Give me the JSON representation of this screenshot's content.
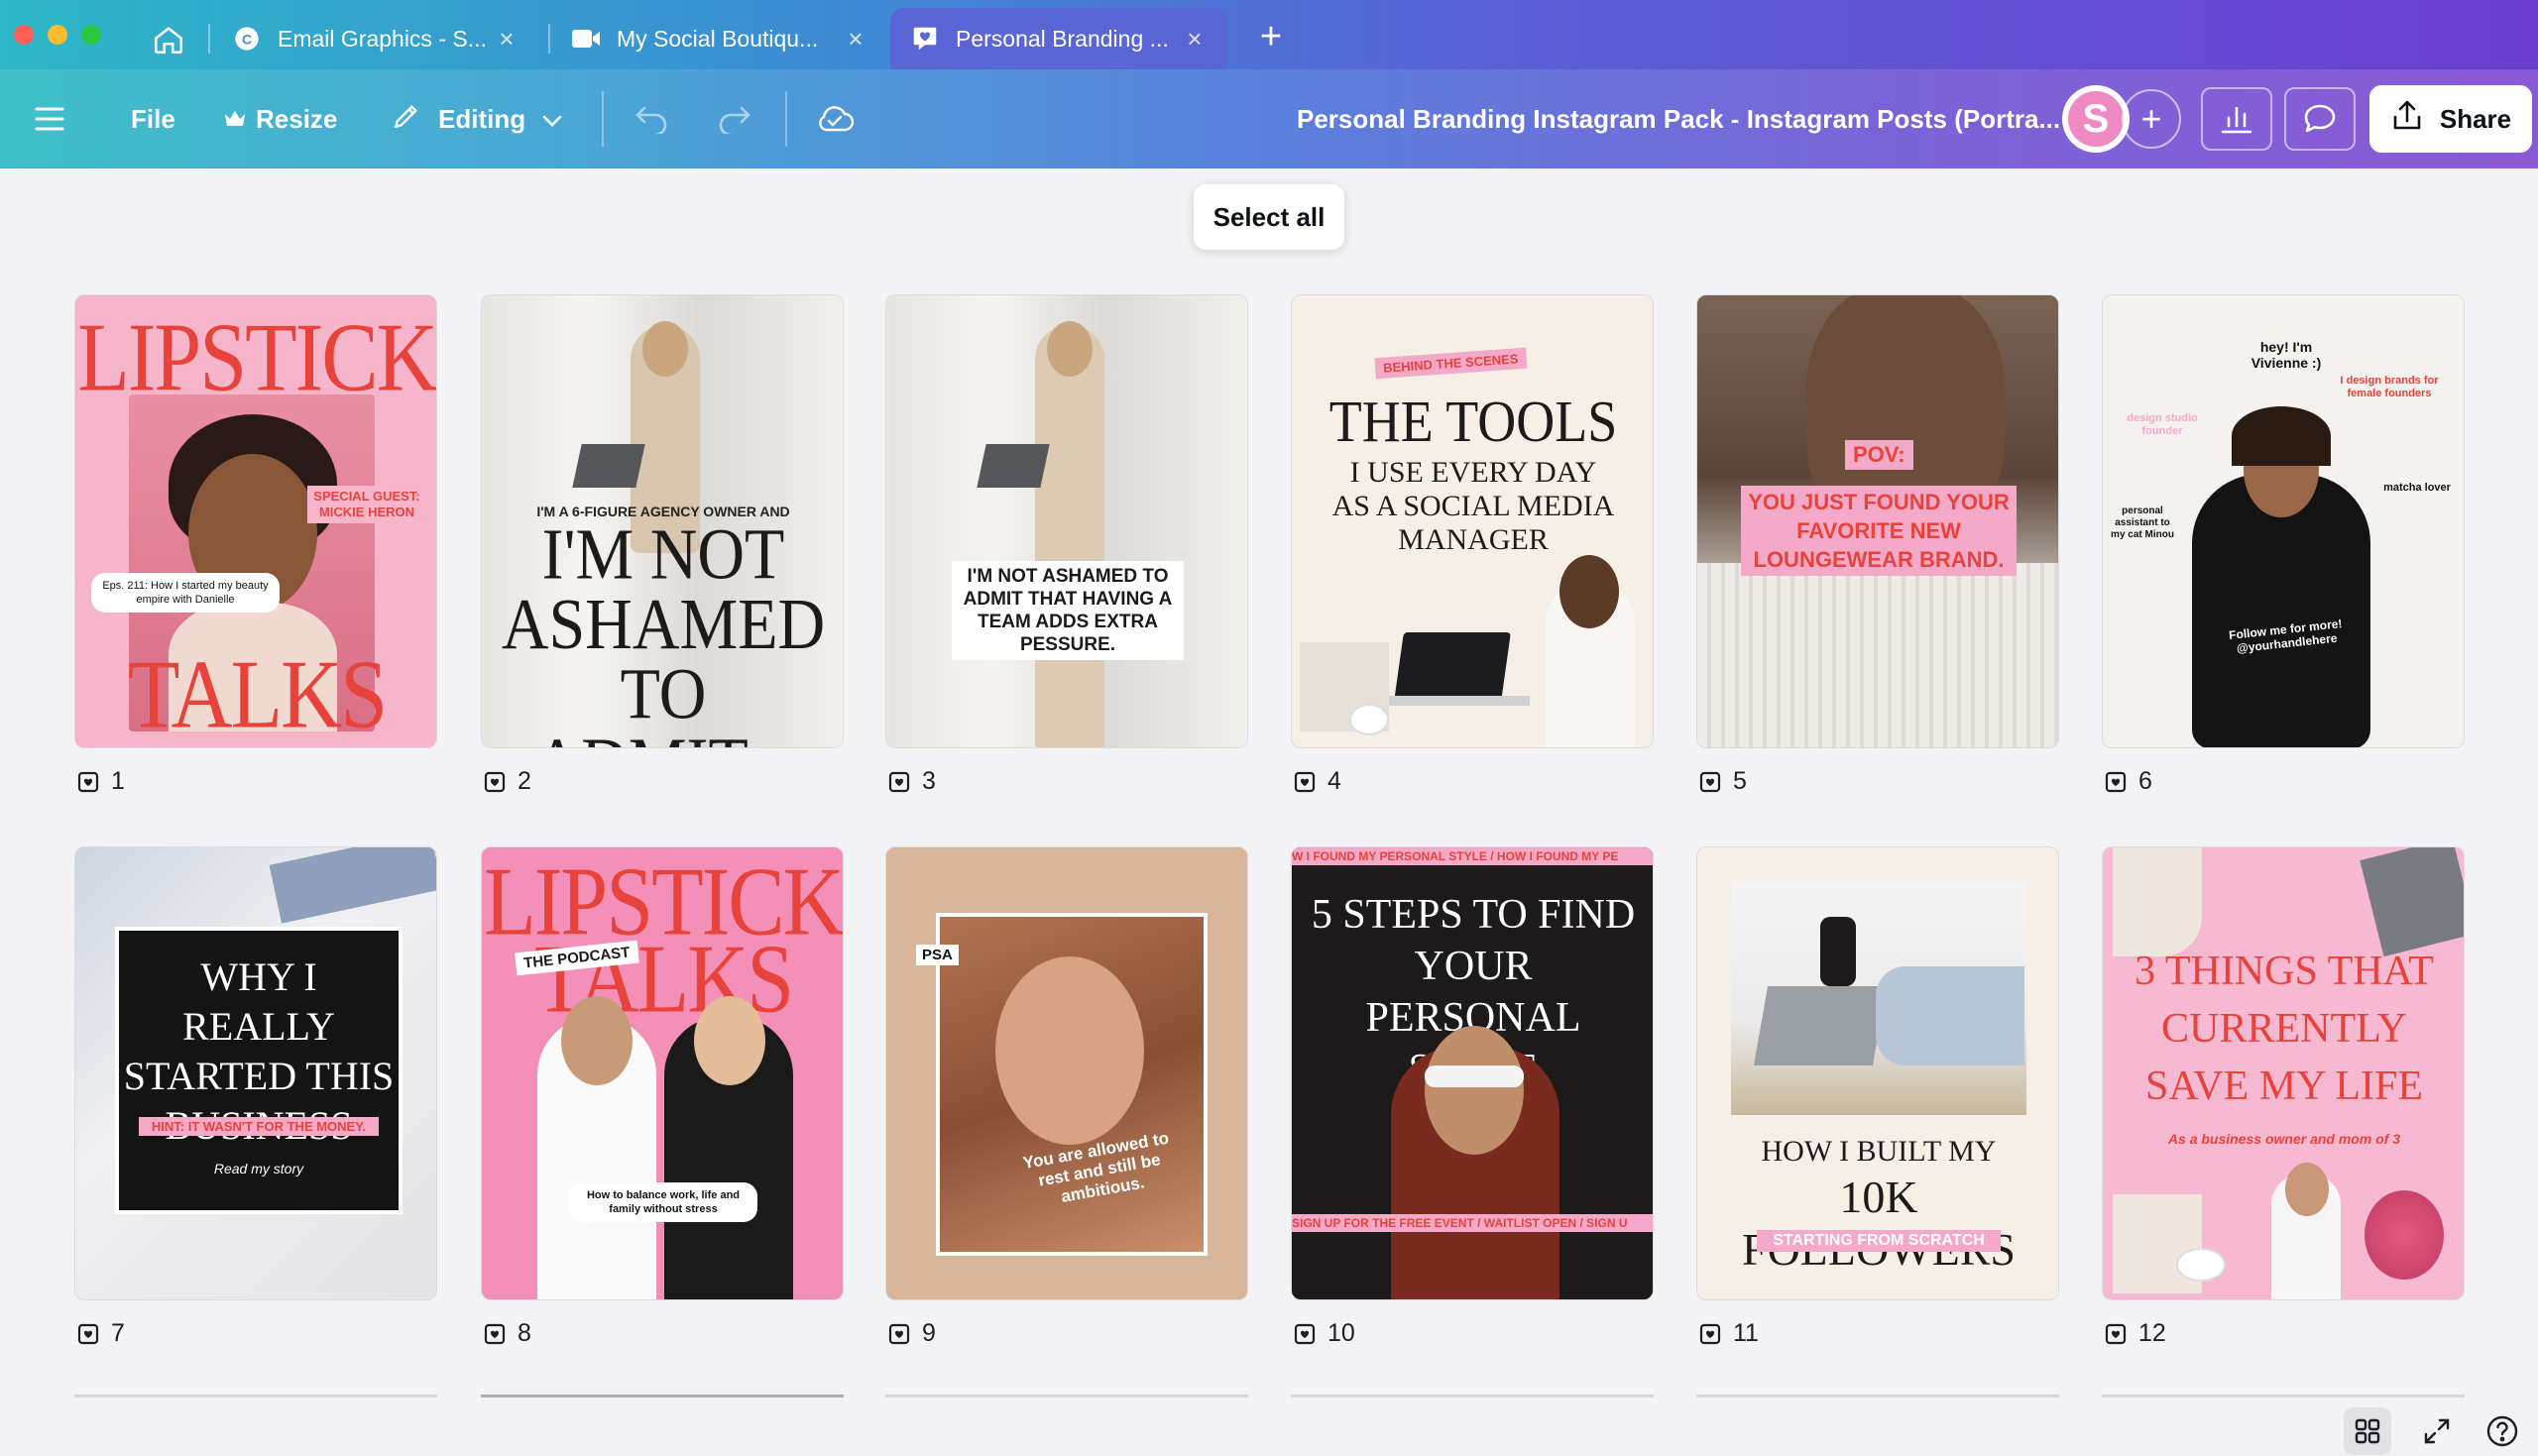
{
  "browser": {
    "tabs": [
      {
        "title": "Email Graphics - S...",
        "icon": "canva-icon"
      },
      {
        "title": "My Social Boutiqu...",
        "icon": "video-icon"
      },
      {
        "title": "Personal Branding ...",
        "icon": "heart-chat-icon",
        "active": true
      }
    ]
  },
  "toolbar": {
    "file": "File",
    "resize": "Resize",
    "editing": "Editing",
    "doc_title": "Personal Branding Instagram Pack - Instagram Posts (Portra...",
    "avatar_initial": "S",
    "share": "Share"
  },
  "select_all": "Select all",
  "pages": [
    {
      "num": "1",
      "lines": {
        "a": "LIPSTICK",
        "b": "TALKS",
        "c": "SPECIAL GUEST: MICKIE HERON",
        "d": "Eps. 211: How I started my beauty empire with Danielle"
      }
    },
    {
      "num": "2",
      "lines": {
        "a": "I'M A 6-FIGURE AGENCY OWNER AND",
        "b": "I'M NOT ASHAMED TO ADMIT..."
      }
    },
    {
      "num": "3",
      "lines": {
        "a": "I'M NOT ASHAMED TO ADMIT THAT HAVING A TEAM ADDS EXTRA PESSURE."
      }
    },
    {
      "num": "4",
      "lines": {
        "a": "BEHIND THE SCENES",
        "b": "THE TOOLS",
        "c": "I USE EVERY DAY AS A SOCIAL MEDIA MANAGER"
      }
    },
    {
      "num": "5",
      "lines": {
        "a": "POV:",
        "b": "YOU JUST FOUND YOUR FAVORITE NEW LOUNGEWEAR BRAND."
      }
    },
    {
      "num": "6",
      "lines": {
        "a": "hey! I'm Vivienne :)",
        "b": "I design brands for female founders",
        "c": "design studio founder",
        "d": "personal assistant to my cat Minou",
        "e": "matcha lover",
        "f": "Follow me for more! @yourhandlehere"
      }
    },
    {
      "num": "7",
      "lines": {
        "a": "WHY I REALLY STARTED THIS BUSINESS",
        "b": "HINT: IT WASN'T FOR THE MONEY.",
        "c": "Read my story"
      }
    },
    {
      "num": "8",
      "lines": {
        "a": "LIPSTICK",
        "b": "TALKS",
        "c": "THE PODCAST",
        "d": "How to balance work, life and family without stress"
      }
    },
    {
      "num": "9",
      "lines": {
        "a": "PSA",
        "b": "You are allowed to rest and still be ambitious."
      }
    },
    {
      "num": "10",
      "lines": {
        "a": "W I FOUND MY PERSONAL STYLE / HOW I FOUND MY PE",
        "b": "5 STEPS TO FIND YOUR PERSONAL STYLE",
        "c": "SIGN UP FOR THE FREE EVENT / WAITLIST OPEN / SIGN U"
      }
    },
    {
      "num": "11",
      "lines": {
        "a": "HOW I BUILT MY",
        "b": "10K FOLLOWERS",
        "c": "STARTING FROM SCRATCH"
      }
    },
    {
      "num": "12",
      "lines": {
        "a": "3 THINGS THAT CURRENTLY SAVE MY LIFE",
        "b": "As a business owner and mom of 3"
      }
    }
  ],
  "colors": {
    "accent_red": "#e8433a",
    "pink": "#f4a9c8",
    "cream": "#f6efe6",
    "dark": "#1c1a1a"
  }
}
